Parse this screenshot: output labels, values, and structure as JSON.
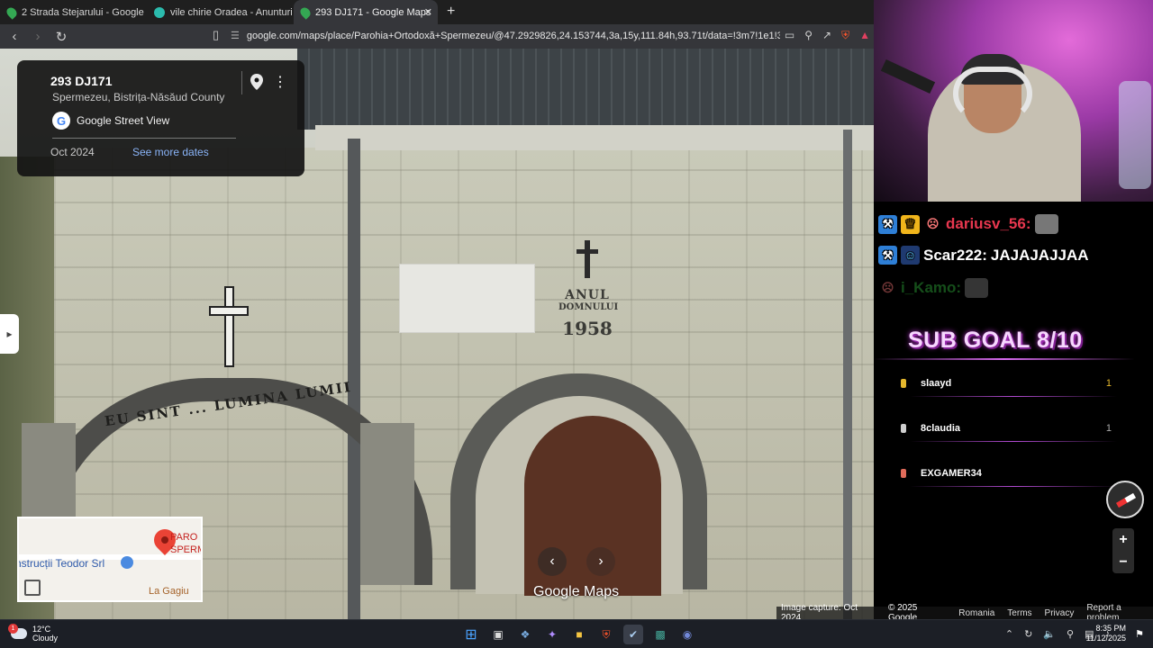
{
  "browser": {
    "tabs": [
      {
        "label": "2 Strada Stejarului - Google Maps",
        "active": false
      },
      {
        "label": "vile chirie Oradea - Anunturi gratuite",
        "active": false
      },
      {
        "label": "293 DJ171 - Google Maps",
        "active": true
      }
    ],
    "new_tab": "+",
    "close": "✕",
    "url": "google.com/maps/place/Parohia+Ortodoxă+Spermezeu/@47.2929826,24.153744,3a,15y,111.84h,93.71t/data=!3m7!1e1!3m5!1soA4xposl..."
  },
  "info_card": {
    "title": "293 DJ171",
    "subtitle": "Spermezeu, Bistrița-Năsăud County",
    "provider": "Google Street View",
    "date": "Oct 2024",
    "more_dates": "See more dates"
  },
  "scene": {
    "inscription_line1": "ANUL",
    "inscription_line2": "DOMNULUI",
    "inscription_year": "1958",
    "gate_text": "EU SINT ... LUMINA LUMII"
  },
  "minimap": {
    "label_business": "nstrucții Teodor Srl",
    "label_place": "PARO\nSPERM",
    "label_place_l1": "PARO",
    "label_place_l2": "SPERM",
    "label_bottom": "La Gagiu"
  },
  "viewer": {
    "brand": "Google Maps",
    "prev": "‹",
    "next": "›",
    "zoom_in": "+",
    "zoom_out": "−"
  },
  "footer": {
    "capture": "Image capture: Oct 2024",
    "copyright": "© 2025 Google",
    "region": "Romania",
    "terms": "Terms",
    "privacy": "Privacy",
    "report": "Report a problem"
  },
  "stream": {
    "chat": [
      {
        "user": "dariusv_56:",
        "message": "",
        "color": "#e8374f"
      },
      {
        "user": "Scar222:",
        "message": "JAJAJAJJAA",
        "color": "#ffffff"
      },
      {
        "user": "i_Kamo:",
        "message": "",
        "color": "#2fae3a"
      }
    ],
    "sub_goal": "SUB GOAL 8/10",
    "leaderboard": [
      {
        "name": "slaayd",
        "count": "1",
        "color": "#e5b82d"
      },
      {
        "name": "8claudia",
        "count": "1",
        "color": "#cfcfcf"
      },
      {
        "name": "EXGAMER34",
        "count": "",
        "color": "#e06b5a"
      }
    ]
  },
  "taskbar": {
    "temp": "12°C",
    "condition": "Cloudy",
    "time": "8:35 PM",
    "date": "11/12/2025",
    "weather_badge": "1"
  }
}
